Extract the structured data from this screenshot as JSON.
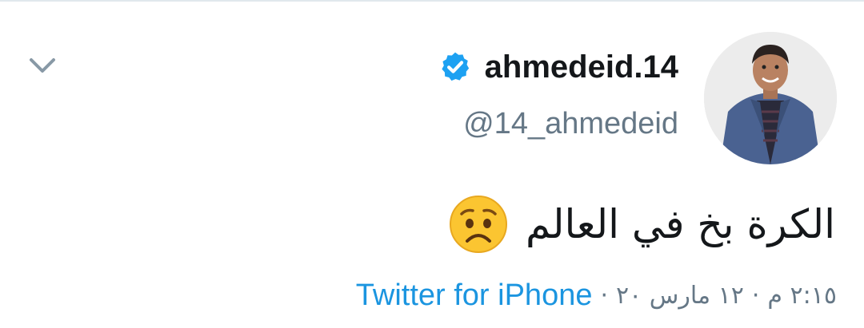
{
  "tweet": {
    "display_name": "ahmedeid.14",
    "handle": "@14_ahmedeid",
    "text": "الكرة بخ في العالم",
    "emoji": "worried-face",
    "time": "٢:١٥ م",
    "date": "١٢ مارس ٢٠",
    "separator": "·",
    "source": "Twitter for iPhone",
    "verified": true
  },
  "icons": {
    "menu": "chevron-down-icon",
    "verified": "verified-badge-icon"
  },
  "colors": {
    "link": "#1b95e0",
    "verified": "#1da1f2",
    "muted": "#657786",
    "text": "#14171a"
  }
}
